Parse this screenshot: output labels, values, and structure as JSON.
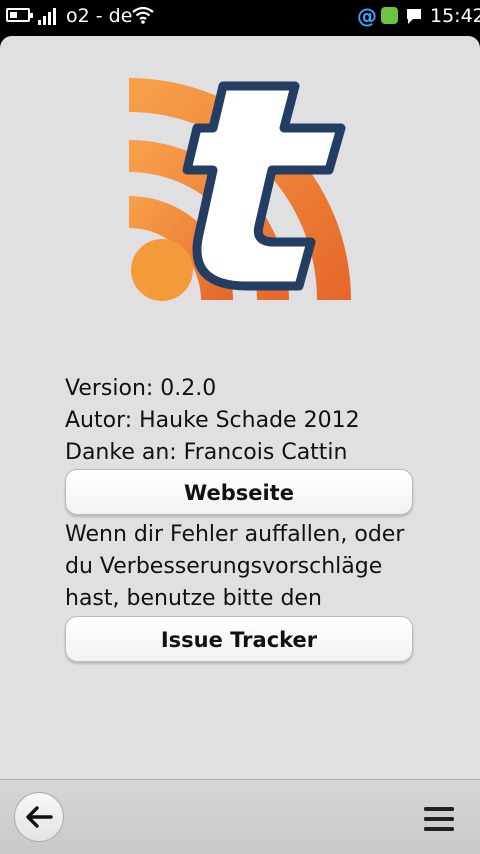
{
  "status_bar": {
    "carrier": "o2 - de",
    "time": "15:42",
    "icons": [
      "battery-icon",
      "signal-icon",
      "wifi-icon",
      "email-at-icon",
      "green-app-icon",
      "chat-bubble-icon"
    ]
  },
  "about": {
    "logo": "tumblr-rss-logo",
    "version": "Version: 0.2.0",
    "author": "Autor: Hauke Schade 2012",
    "thanks": "Danke an: Francois Cattin",
    "website_button": "Webseite",
    "bug_text_lines": [
      "Wenn dir Fehler auffallen, oder",
      "du Verbesserungsvorschläge",
      "hast, benutze bitte den"
    ],
    "issue_button": "Issue Tracker"
  },
  "toolbar": {
    "back_icon": "back-arrow-icon",
    "menu_icon": "menu-icon"
  },
  "colors": {
    "orange": "#f0892a",
    "navy": "#243d63",
    "background": "#e0e0e2"
  }
}
